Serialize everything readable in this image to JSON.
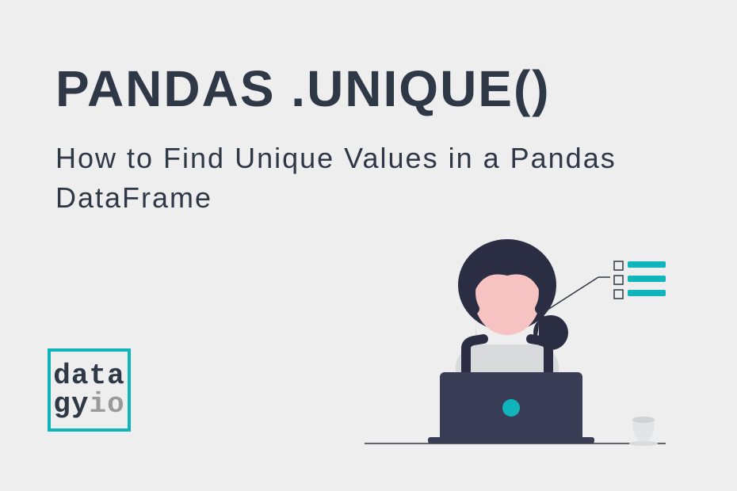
{
  "title": "PANDAS .UNIQUE()",
  "subtitle": "How to Find Unique Values in a Pandas DataFrame",
  "logo": {
    "line1": "data",
    "gy": "gy",
    "io": "io"
  },
  "colors": {
    "dark": "#2f3847",
    "teal": "#0fb5ba",
    "bg": "#eeeeee",
    "gray": "#9a9a9a",
    "skin": "#f6c3c2",
    "light": "#d9dadb"
  }
}
